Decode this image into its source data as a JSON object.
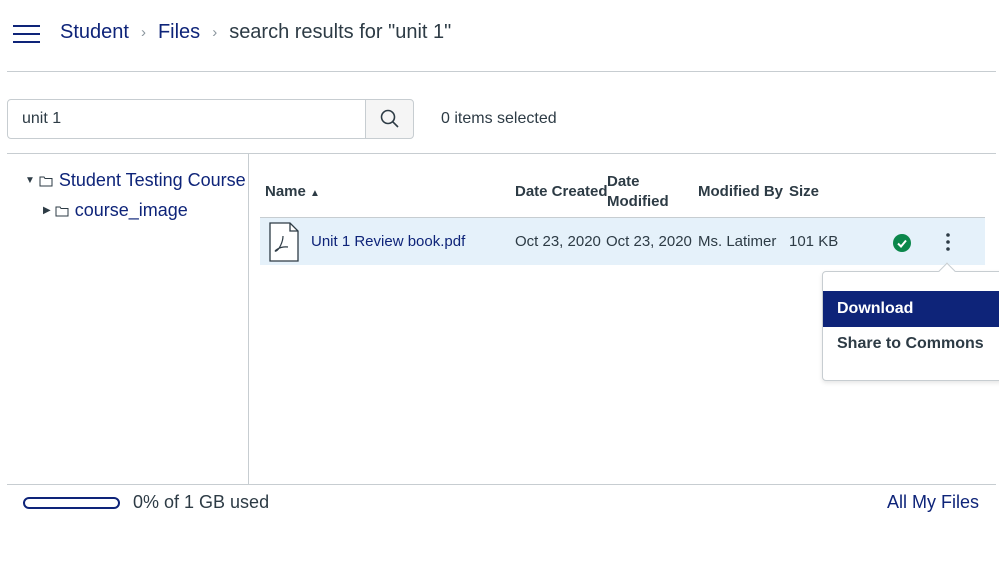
{
  "breadcrumb": {
    "items": [
      "Student",
      "Files"
    ],
    "current": "search results for \"unit 1\""
  },
  "search": {
    "value": "unit 1"
  },
  "selection": "0 items selected",
  "tree": {
    "root": "Student Testing Course",
    "child": "course_image"
  },
  "table": {
    "headers": {
      "name": "Name",
      "date_created": "Date Created",
      "date_modified_1": "Date",
      "date_modified_2": "Modified",
      "modified_by": "Modified By",
      "size": "Size"
    },
    "rows": [
      {
        "name": "Unit 1 Review book.pdf",
        "date_created": "Oct 23, 2020",
        "date_modified": "Oct 23, 2020",
        "modified_by": "Ms. Latimer",
        "size": "101 KB",
        "status": "published"
      }
    ]
  },
  "menu": {
    "items": [
      "Download",
      "Share to Commons"
    ]
  },
  "footer": {
    "quota": "0% of 1 GB used",
    "quota_percent": 0,
    "all_files": "All My Files"
  },
  "colors": {
    "brand": "#0e2479",
    "published": "#0b874b",
    "row_highlight": "#e5f1fa"
  }
}
